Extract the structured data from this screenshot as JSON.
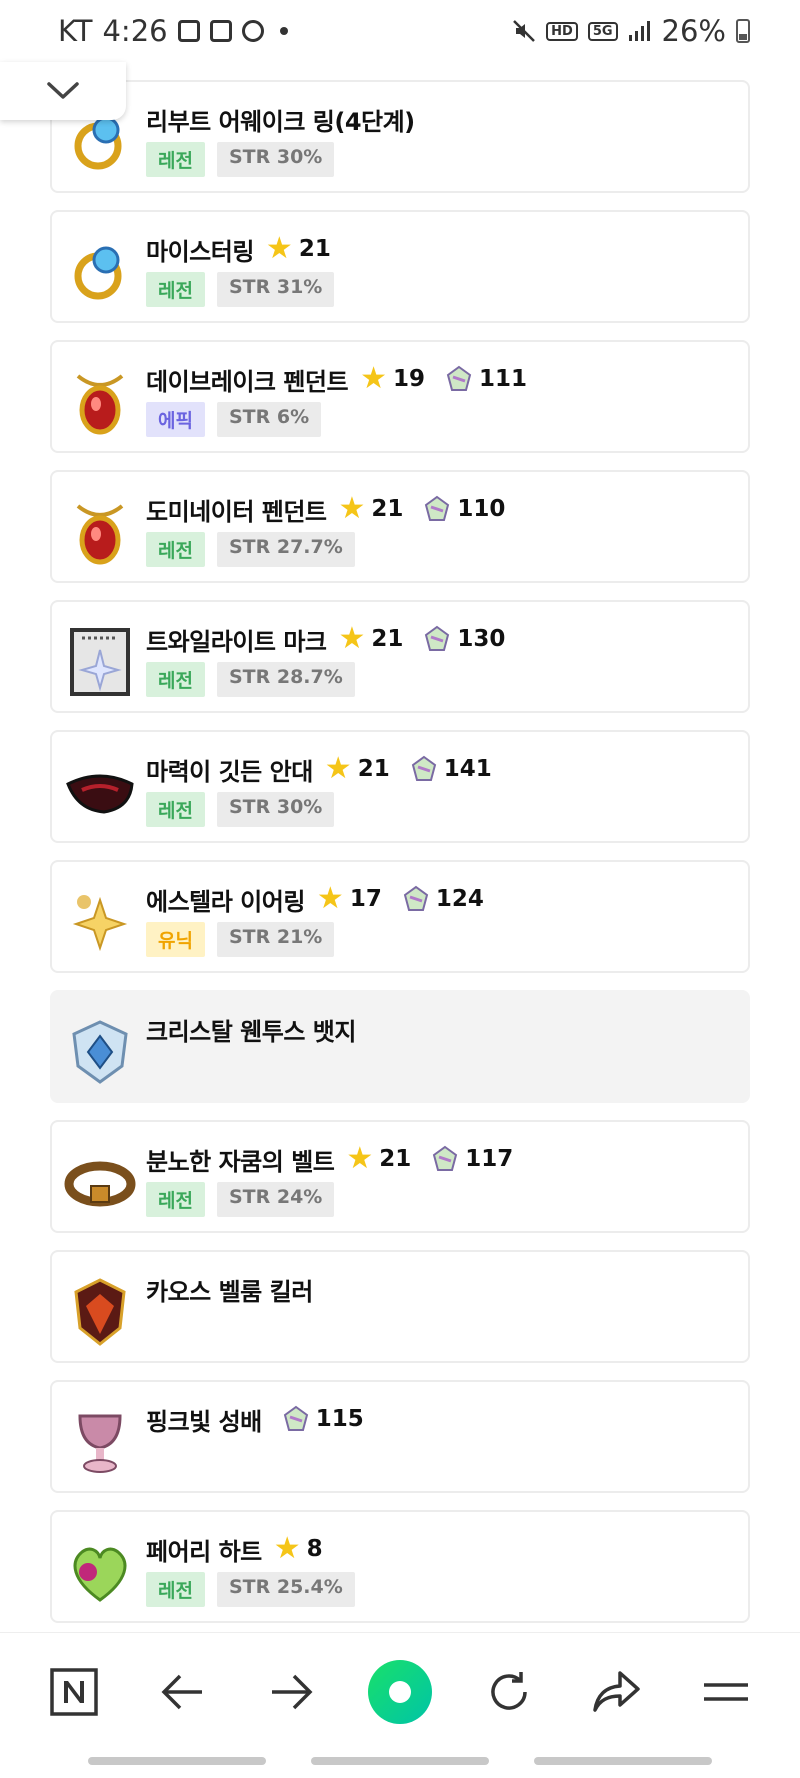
{
  "status_bar": {
    "carrier": "KT",
    "time": "4:26",
    "network": "5G",
    "hd_label": "HD",
    "battery": "26%"
  },
  "items": [
    {
      "name": "리부트 어웨이크 링(4단계)",
      "star": null,
      "gem": null,
      "grade": "레전",
      "grade_type": "legend",
      "stat": "STR 30%",
      "icon": "ring-icon"
    },
    {
      "name": "마이스터링",
      "star": "21",
      "gem": null,
      "grade": "레전",
      "grade_type": "legend",
      "stat": "STR 31%",
      "icon": "ring-icon"
    },
    {
      "name": "데이브레이크 펜던트",
      "star": "19",
      "gem": "111",
      "grade": "에픽",
      "grade_type": "epic",
      "stat": "STR 6%",
      "icon": "pendant-icon"
    },
    {
      "name": "도미네이터 펜던트",
      "star": "21",
      "gem": "110",
      "grade": "레전",
      "grade_type": "legend",
      "stat": "STR 27.7%",
      "icon": "pendant-icon"
    },
    {
      "name": "트와일라이트 마크",
      "star": "21",
      "gem": "130",
      "grade": "레전",
      "grade_type": "legend",
      "stat": "STR 28.7%",
      "icon": "mark-icon"
    },
    {
      "name": "마력이 깃든 안대",
      "star": "21",
      "gem": "141",
      "grade": "레전",
      "grade_type": "legend",
      "stat": "STR 30%",
      "icon": "eyepatch-icon"
    },
    {
      "name": "에스텔라 이어링",
      "star": "17",
      "gem": "124",
      "grade": "유닉",
      "grade_type": "unique",
      "stat": "STR 21%",
      "icon": "earring-icon"
    },
    {
      "name": "크리스탈 웬투스 뱃지",
      "star": null,
      "gem": null,
      "grade": null,
      "grade_type": null,
      "stat": null,
      "icon": "badge-icon"
    },
    {
      "name": "분노한 자쿰의 벨트",
      "star": "21",
      "gem": "117",
      "grade": "레전",
      "grade_type": "legend",
      "stat": "STR 24%",
      "icon": "belt-icon"
    },
    {
      "name": "카오스 벨룸 킬러",
      "star": null,
      "gem": null,
      "grade": null,
      "grade_type": null,
      "stat": null,
      "icon": "shoulder-icon"
    },
    {
      "name": "핑크빛 성배",
      "star": null,
      "gem": "115",
      "grade": null,
      "grade_type": null,
      "stat": null,
      "icon": "chalice-icon"
    },
    {
      "name": "페어리 하트",
      "star": "8",
      "gem": null,
      "grade": "레전",
      "grade_type": "legend",
      "stat": "STR 25.4%",
      "icon": "heart-icon"
    }
  ],
  "colors": {
    "legend_bg": "#d8f1dc",
    "legend_fg": "#3aa85a",
    "epic_bg": "#e2e2fb",
    "epic_fg": "#6b64e0",
    "unique_bg": "#fff2c4",
    "unique_fg": "#f0a400",
    "star": "#f5c518",
    "nav_accent": "#1ed760"
  },
  "nav": [
    "naver-home-icon",
    "back-arrow-icon",
    "forward-arrow-icon",
    "green-dot-icon",
    "refresh-icon",
    "share-icon",
    "menu-icon"
  ]
}
